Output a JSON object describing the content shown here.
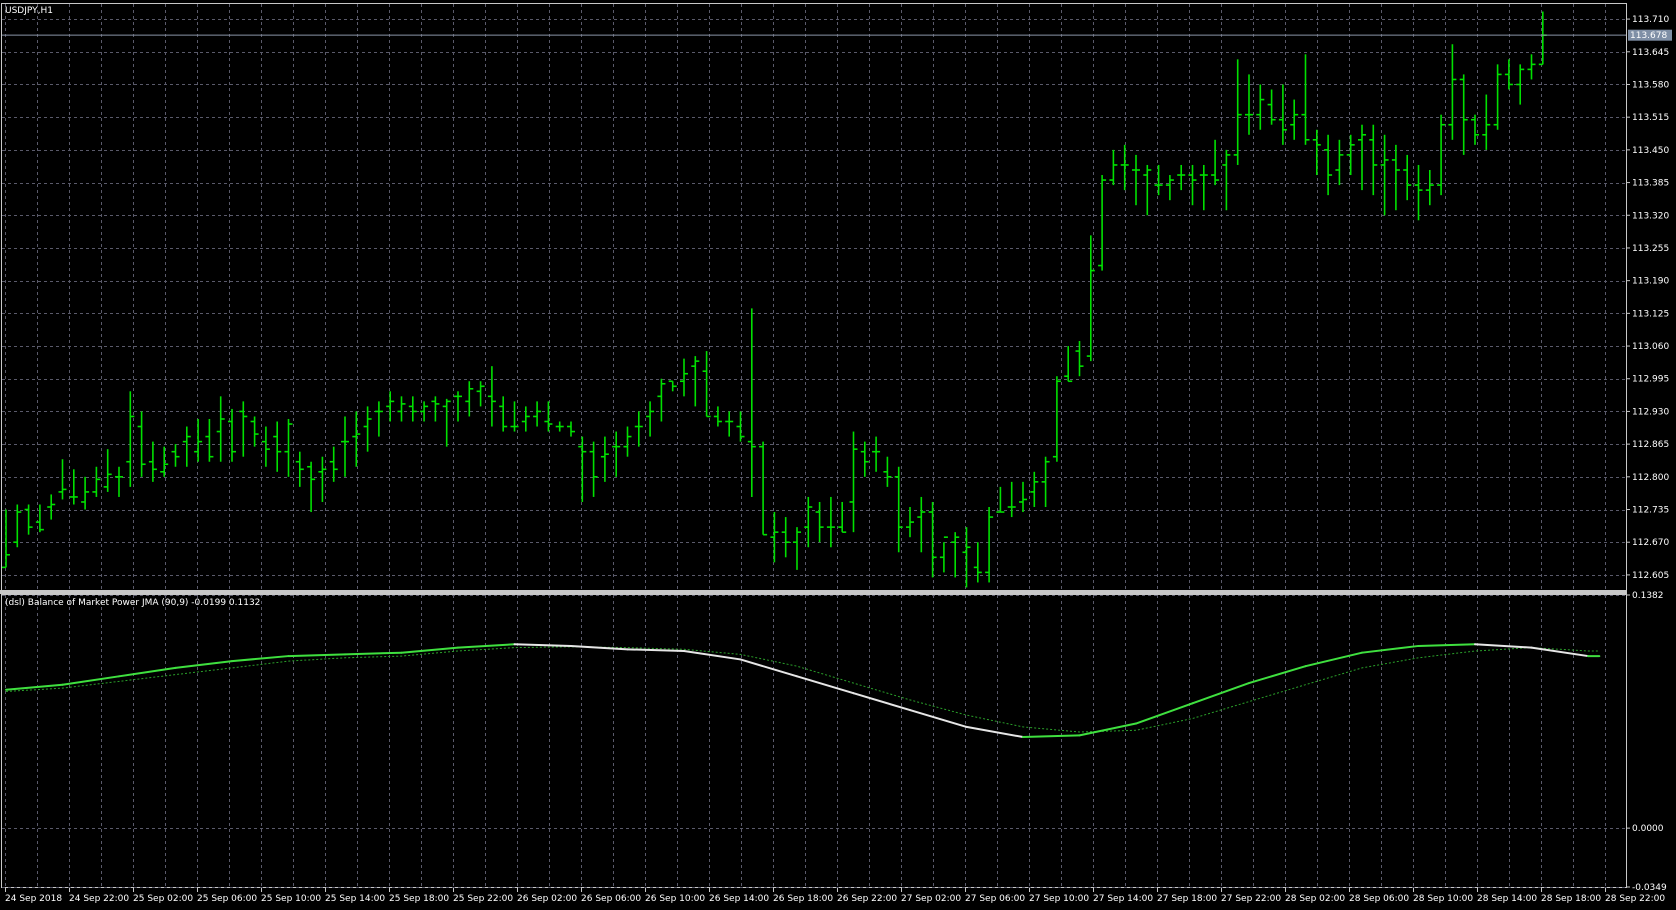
{
  "window": {
    "title": "USDJPY,H1"
  },
  "colors": {
    "background": "#000000",
    "grid": "#5a5a6a",
    "bar": "#00e000",
    "bmp_up": "#3fe03f",
    "bmp_down": "#e6e6e6",
    "signal": "#2aa02a",
    "text": "#ffffff",
    "current_price_bg": "#7f8fa6"
  },
  "price_panel": {
    "current_price_label": "113.678",
    "current_price": 113.678
  },
  "indicator_panel": {
    "title": "(dsl) Balance of Market Power JMA (90,9) -0.0199 0.1132"
  },
  "chart_data": [
    {
      "type": "ohlc",
      "symbol": "USDJPY",
      "timeframe": "H1",
      "ylim": [
        112.575,
        113.74
      ],
      "y_ticks": [
        "113.710",
        "113.645",
        "113.580",
        "113.515",
        "113.450",
        "113.385",
        "113.320",
        "113.255",
        "113.190",
        "113.125",
        "113.060",
        "112.995",
        "112.930",
        "112.865",
        "112.800",
        "112.735",
        "112.670",
        "112.605"
      ],
      "x_ticks": [
        "24 Sep 2018",
        "24 Sep 22:00",
        "25 Sep 02:00",
        "25 Sep 06:00",
        "25 Sep 10:00",
        "25 Sep 14:00",
        "25 Sep 18:00",
        "25 Sep 22:00",
        "26 Sep 02:00",
        "26 Sep 06:00",
        "26 Sep 10:00",
        "26 Sep 14:00",
        "26 Sep 18:00",
        "26 Sep 22:00",
        "27 Sep 02:00",
        "27 Sep 06:00",
        "27 Sep 10:00",
        "27 Sep 14:00",
        "27 Sep 18:00",
        "27 Sep 22:00",
        "28 Sep 02:00",
        "28 Sep 06:00",
        "28 Sep 10:00",
        "28 Sep 14:00",
        "28 Sep 18:00",
        "28 Sep 22:00"
      ],
      "ohlc": [
        [
          112.62,
          112.62,
          112.735,
          112.645
        ],
        [
          112.67,
          112.745,
          112.66,
          112.73
        ],
        [
          112.735,
          112.745,
          112.685,
          112.7
        ],
        [
          112.71,
          112.745,
          112.69,
          112.695
        ],
        [
          112.74,
          112.765,
          112.715,
          112.745
        ],
        [
          112.77,
          112.835,
          112.755,
          112.775
        ],
        [
          112.76,
          112.815,
          112.745,
          112.76
        ],
        [
          112.75,
          112.8,
          112.735,
          112.77
        ],
        [
          112.77,
          112.82,
          112.76,
          112.795
        ],
        [
          112.78,
          112.855,
          112.77,
          112.805
        ],
        [
          112.8,
          112.82,
          112.76,
          112.8
        ],
        [
          112.83,
          112.97,
          112.78,
          112.92
        ],
        [
          112.9,
          112.93,
          112.8,
          112.825
        ],
        [
          112.83,
          112.87,
          112.79,
          112.815
        ],
        [
          112.81,
          112.86,
          112.8,
          112.825
        ],
        [
          112.85,
          112.865,
          112.82,
          112.84
        ],
        [
          112.87,
          112.9,
          112.82,
          112.88
        ],
        [
          112.85,
          112.915,
          112.83,
          112.87
        ],
        [
          112.88,
          112.915,
          112.83,
          112.84
        ],
        [
          112.89,
          112.96,
          112.83,
          112.915
        ],
        [
          112.91,
          112.935,
          112.83,
          112.85
        ],
        [
          112.93,
          112.95,
          112.84,
          112.92
        ],
        [
          112.91,
          112.92,
          112.86,
          112.885
        ],
        [
          112.87,
          112.9,
          112.82,
          112.855
        ],
        [
          112.88,
          112.91,
          112.81,
          112.85
        ],
        [
          112.85,
          112.915,
          112.8,
          112.905
        ],
        [
          112.83,
          112.85,
          112.78,
          112.815
        ],
        [
          112.82,
          112.83,
          112.73,
          112.795
        ],
        [
          112.81,
          112.84,
          112.75,
          112.815
        ],
        [
          112.83,
          112.86,
          112.79,
          112.815
        ],
        [
          112.87,
          112.92,
          112.8,
          112.87
        ],
        [
          112.88,
          112.93,
          112.82,
          112.885
        ],
        [
          112.9,
          112.94,
          112.85,
          112.915
        ],
        [
          112.93,
          112.95,
          112.88,
          112.93
        ],
        [
          112.94,
          112.97,
          112.91,
          112.95
        ],
        [
          112.93,
          112.96,
          112.91,
          112.945
        ],
        [
          112.94,
          112.96,
          112.91,
          112.93
        ],
        [
          112.93,
          112.95,
          112.91,
          112.94
        ],
        [
          112.95,
          112.96,
          112.91,
          112.945
        ],
        [
          112.94,
          112.955,
          112.86,
          112.95
        ],
        [
          112.96,
          112.97,
          112.91,
          112.96
        ],
        [
          112.95,
          112.99,
          112.92,
          112.975
        ],
        [
          112.97,
          112.99,
          112.94,
          112.98
        ],
        [
          112.96,
          113.02,
          112.9,
          112.95
        ],
        [
          112.94,
          112.96,
          112.89,
          112.9
        ],
        [
          112.9,
          112.95,
          112.89,
          112.9
        ],
        [
          112.91,
          112.94,
          112.89,
          112.92
        ],
        [
          112.92,
          112.95,
          112.9,
          112.93
        ],
        [
          112.91,
          112.95,
          112.89,
          112.905
        ],
        [
          112.9,
          112.91,
          112.89,
          112.9
        ],
        [
          112.9,
          112.91,
          112.88,
          112.89
        ],
        [
          112.86,
          112.88,
          112.75,
          112.85
        ],
        [
          112.85,
          112.87,
          112.76,
          112.8
        ],
        [
          112.84,
          112.88,
          112.79,
          112.845
        ],
        [
          112.86,
          112.89,
          112.8,
          112.86
        ],
        [
          112.86,
          112.9,
          112.84,
          112.88
        ],
        [
          112.9,
          112.93,
          112.86,
          112.9
        ],
        [
          112.92,
          112.95,
          112.88,
          112.93
        ],
        [
          112.96,
          112.995,
          112.91,
          112.985
        ],
        [
          112.99,
          112.99,
          112.97,
          112.98
        ],
        [
          112.99,
          113.035,
          112.96,
          113.005
        ],
        [
          113.02,
          113.04,
          112.94,
          113.03
        ],
        [
          113.01,
          113.05,
          112.92,
          112.92
        ],
        [
          112.92,
          112.94,
          112.9,
          112.91
        ],
        [
          112.91,
          112.93,
          112.88,
          112.91
        ],
        [
          112.9,
          112.93,
          112.87,
          112.88
        ],
        [
          112.87,
          113.135,
          112.76,
          112.86
        ],
        [
          112.86,
          112.87,
          112.685,
          112.685
        ],
        [
          112.68,
          112.73,
          112.63,
          112.69
        ],
        [
          112.69,
          112.72,
          112.64,
          112.67
        ],
        [
          112.67,
          112.7,
          112.615,
          112.69
        ],
        [
          112.7,
          112.76,
          112.66,
          112.74
        ],
        [
          112.73,
          112.75,
          112.67,
          112.7
        ],
        [
          112.7,
          112.76,
          112.66,
          112.7
        ],
        [
          112.7,
          112.75,
          112.69,
          112.69
        ],
        [
          112.75,
          112.89,
          112.69,
          112.855
        ],
        [
          112.85,
          112.87,
          112.8,
          112.83
        ],
        [
          112.85,
          112.88,
          112.81,
          112.85
        ],
        [
          112.81,
          112.84,
          112.78,
          112.8
        ],
        [
          112.8,
          112.82,
          112.65,
          112.7
        ],
        [
          112.7,
          112.74,
          112.68,
          112.71
        ],
        [
          112.72,
          112.76,
          112.65,
          112.73
        ],
        [
          112.73,
          112.75,
          112.6,
          112.64
        ],
        [
          112.64,
          112.67,
          112.61,
          112.68
        ],
        [
          112.67,
          112.69,
          112.6,
          112.68
        ],
        [
          112.65,
          112.7,
          112.58,
          112.66
        ],
        [
          112.62,
          112.67,
          112.59,
          112.61
        ],
        [
          112.61,
          112.74,
          112.59,
          112.72
        ],
        [
          112.73,
          112.78,
          112.73,
          112.73
        ],
        [
          112.74,
          112.79,
          112.72,
          112.74
        ],
        [
          112.75,
          112.79,
          112.73,
          112.755
        ],
        [
          112.77,
          112.81,
          112.74,
          112.79
        ],
        [
          112.79,
          112.84,
          112.74,
          112.83
        ],
        [
          112.84,
          113.0,
          112.83,
          112.99
        ],
        [
          113.0,
          113.06,
          112.99,
          112.99
        ],
        [
          113.05,
          113.07,
          113.0,
          113.02
        ],
        [
          113.04,
          113.28,
          113.03,
          113.21
        ],
        [
          113.22,
          113.4,
          113.21,
          113.39
        ],
        [
          113.39,
          113.45,
          113.38,
          113.42
        ],
        [
          113.42,
          113.46,
          113.37,
          113.42
        ],
        [
          113.41,
          113.44,
          113.34,
          113.41
        ],
        [
          113.4,
          113.42,
          113.32,
          113.41
        ],
        [
          113.38,
          113.42,
          113.36,
          113.38
        ],
        [
          113.38,
          113.4,
          113.35,
          113.39
        ],
        [
          113.4,
          113.42,
          113.37,
          113.4
        ],
        [
          113.4,
          113.42,
          113.34,
          113.39
        ],
        [
          113.4,
          113.42,
          113.33,
          113.4
        ],
        [
          113.4,
          113.47,
          113.38,
          113.39
        ],
        [
          113.42,
          113.45,
          113.33,
          113.44
        ],
        [
          113.44,
          113.63,
          113.42,
          113.52
        ],
        [
          113.52,
          113.6,
          113.48,
          113.52
        ],
        [
          113.52,
          113.58,
          113.49,
          113.55
        ],
        [
          113.54,
          113.57,
          113.5,
          113.51
        ],
        [
          113.51,
          113.58,
          113.46,
          113.49
        ],
        [
          113.5,
          113.55,
          113.47,
          113.52
        ],
        [
          113.52,
          113.64,
          113.46,
          113.47
        ],
        [
          113.47,
          113.49,
          113.4,
          113.46
        ],
        [
          113.45,
          113.48,
          113.36,
          113.4
        ],
        [
          113.41,
          113.47,
          113.38,
          113.44
        ],
        [
          113.44,
          113.48,
          113.4,
          113.46
        ],
        [
          113.47,
          113.5,
          113.37,
          113.48
        ],
        [
          113.47,
          113.5,
          113.36,
          113.42
        ],
        [
          113.42,
          113.48,
          113.32,
          113.43
        ],
        [
          113.43,
          113.46,
          113.33,
          113.41
        ],
        [
          113.41,
          113.44,
          113.35,
          113.38
        ],
        [
          113.38,
          113.42,
          113.31,
          113.37
        ],
        [
          113.37,
          113.41,
          113.34,
          113.38
        ],
        [
          113.38,
          113.52,
          113.36,
          113.5
        ],
        [
          113.5,
          113.66,
          113.47,
          113.59
        ],
        [
          113.59,
          113.6,
          113.44,
          113.51
        ],
        [
          113.51,
          113.52,
          113.46,
          113.48
        ],
        [
          113.48,
          113.56,
          113.45,
          113.5
        ],
        [
          113.5,
          113.62,
          113.49,
          113.6
        ],
        [
          113.6,
          113.63,
          113.57,
          113.58
        ],
        [
          113.58,
          113.62,
          113.54,
          113.61
        ],
        [
          113.61,
          113.64,
          113.59,
          113.62
        ],
        [
          113.62,
          113.725,
          113.62,
          113.678
        ]
      ]
    },
    {
      "type": "line",
      "title": "(dsl) Balance of Market Power JMA (90,9) -0.0199 0.1132",
      "ylim": [
        -0.0349,
        0.1382
      ],
      "y_ticks": [
        "0.1382",
        "0.0000",
        "-0.0349"
      ],
      "series": [
        {
          "role": "main",
          "x": [
            0,
            5,
            10,
            15,
            20,
            25,
            30,
            35,
            40,
            45,
            50,
            55,
            60,
            65,
            70,
            75,
            80,
            85,
            90,
            95,
            100,
            105,
            110,
            115,
            120,
            125,
            130,
            135,
            140,
            141
          ],
          "values": [
            0.082,
            0.085,
            0.09,
            0.095,
            0.099,
            0.102,
            0.103,
            0.104,
            0.107,
            0.109,
            0.108,
            0.106,
            0.105,
            0.1,
            0.09,
            0.08,
            0.07,
            0.06,
            0.054,
            0.055,
            0.062,
            0.074,
            0.086,
            0.096,
            0.104,
            0.108,
            0.109,
            0.107,
            0.102,
            0.102
          ]
        },
        {
          "role": "signal",
          "x": [
            0,
            5,
            10,
            15,
            20,
            25,
            30,
            35,
            40,
            45,
            50,
            55,
            60,
            65,
            70,
            75,
            80,
            85,
            90,
            95,
            100,
            105,
            110,
            115,
            120,
            125,
            130,
            135,
            140,
            141
          ],
          "values": [
            0.081,
            0.083,
            0.087,
            0.091,
            0.095,
            0.099,
            0.101,
            0.102,
            0.105,
            0.107,
            0.1075,
            0.107,
            0.106,
            0.103,
            0.096,
            0.086,
            0.076,
            0.067,
            0.06,
            0.057,
            0.058,
            0.065,
            0.075,
            0.085,
            0.095,
            0.101,
            0.105,
            0.107,
            0.105,
            0.105
          ]
        }
      ]
    }
  ]
}
